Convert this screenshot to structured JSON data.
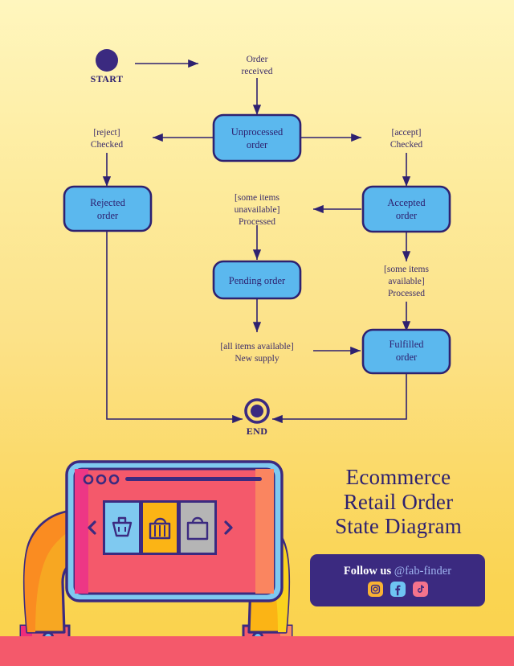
{
  "poster": {
    "background_top": "#FFF6BE",
    "background_bottom": "#FAD24C",
    "ink": "#2E2170",
    "state_fill": "#5BB8EE",
    "band_color": "#F4596B"
  },
  "diagram": {
    "type": "uml-state-diagram",
    "start": {
      "label": "START"
    },
    "end": {
      "label": "END"
    },
    "states": [
      {
        "id": "unprocessed",
        "label_lines": [
          "Unprocessed",
          "order"
        ]
      },
      {
        "id": "rejected",
        "label_lines": [
          "Rejected",
          "order"
        ]
      },
      {
        "id": "accepted",
        "label_lines": [
          "Accepted",
          "order"
        ]
      },
      {
        "id": "pending",
        "label_lines": [
          "Pending order"
        ]
      },
      {
        "id": "fulfilled",
        "label_lines": [
          "Fulfilled",
          "order"
        ]
      }
    ],
    "transitions": [
      {
        "from": "start",
        "to": "unprocessed",
        "label_lines": [
          "Order",
          "received"
        ]
      },
      {
        "from": "unprocessed",
        "to": "rejected",
        "label_lines": [
          "[reject]",
          "Checked"
        ]
      },
      {
        "from": "unprocessed",
        "to": "accepted",
        "label_lines": [
          "[accept]",
          "Checked"
        ]
      },
      {
        "from": "accepted",
        "to": "pending",
        "label_lines": [
          "[some items",
          "unavailable]",
          "Processed"
        ]
      },
      {
        "from": "accepted",
        "to": "fulfilled",
        "label_lines": [
          "[some items",
          "available]",
          "Processed"
        ]
      },
      {
        "from": "pending",
        "to": "fulfilled",
        "label_lines": [
          "[all items available]",
          "New supply"
        ]
      },
      {
        "from": "rejected",
        "to": "end",
        "label_lines": []
      },
      {
        "from": "fulfilled",
        "to": "end",
        "label_lines": []
      }
    ]
  },
  "title": {
    "line1": "Ecommerce",
    "line2": "Retail Order",
    "line3": "State Diagram"
  },
  "follow": {
    "prefix": "Follow us",
    "handle": "@fab-finder",
    "icons": [
      "instagram-icon",
      "facebook-icon",
      "tiktok-icon"
    ],
    "card_color": "#3B2A80",
    "instagram_color": "#F9B233",
    "facebook_color": "#6EC4F2",
    "tiktok_color": "#F4738C"
  },
  "illustration": {
    "name": "hands-holding-tablet",
    "screen_color": "#F4596B",
    "bezel_color": "#6EC4F2",
    "cards": [
      {
        "icon": "shopping-basket-icon",
        "bg": "#7FC9F0"
      },
      {
        "icon": "shopping-bag-striped-icon",
        "bg": "#FBB415"
      },
      {
        "icon": "shopping-bag-icon",
        "bg": "#B5B5B5"
      }
    ],
    "prev_arrow": "chevron-left-icon",
    "next_arrow": "chevron-right-icon",
    "dots": 3
  }
}
